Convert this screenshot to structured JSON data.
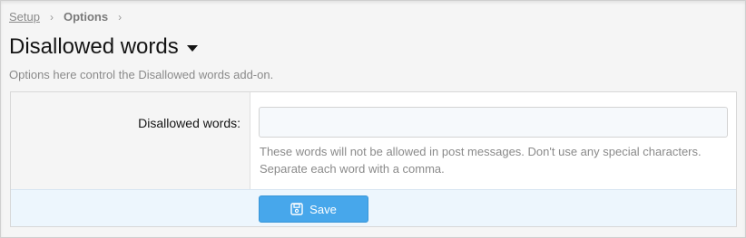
{
  "breadcrumb": {
    "items": [
      "Setup",
      "Options"
    ],
    "separator": "›"
  },
  "page": {
    "title": "Disallowed words",
    "description": "Options here control the Disallowed words add-on."
  },
  "form": {
    "label": "Disallowed words:",
    "input_value": "",
    "explain_line1": "These words will not be allowed in post messages. Don't use any special characters.",
    "explain_line2": "Separate each word with a comma."
  },
  "footer": {
    "save_label": "Save"
  },
  "colors": {
    "accent": "#47a7eb",
    "footer_bg": "#edf6fd",
    "muted_text": "#8a8a8a"
  },
  "icons": {
    "title_caret": "caret-down-icon",
    "save": "floppy-disk-icon",
    "breadcrumb_separator": "chevron-right-icon"
  }
}
